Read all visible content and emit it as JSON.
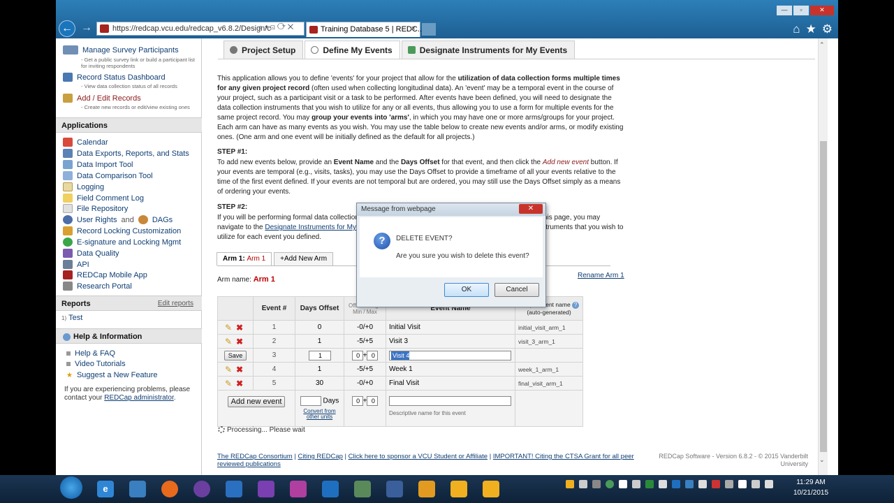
{
  "browser": {
    "url": "https://redcap.vcu.edu/redcap_v6.8.2/Design/c",
    "tab_title": "Training Database 5 | REDC...",
    "tab_close": "×",
    "back": "←",
    "forward": "→",
    "win_min": "—",
    "win_max": "▫",
    "win_close": "✕",
    "home": "⌂",
    "star": "★",
    "gear": "⚙",
    "addr_tools": "⌕ ▾ ⊡ ⟳ ✕"
  },
  "sidebar": {
    "top_items": [
      {
        "label": "Manage Survey Participants",
        "sub": "- Get a public survey link or build a participant list for inviting respondents"
      },
      {
        "label": "Record Status Dashboard",
        "sub": "- View data collection status of all records"
      },
      {
        "label": "Add / Edit Records",
        "sub": "- Create new records or edit/view existing ones"
      }
    ],
    "applications_header": "Applications",
    "applications": [
      "Calendar",
      "Data Exports, Reports, and Stats",
      "Data Import Tool",
      "Data Comparison Tool",
      "Logging",
      "Field Comment Log",
      "File Repository",
      "User Rights",
      "and",
      "DAGs",
      "Record Locking Customization",
      "E-signature and Locking Mgmt",
      "Data Quality",
      "API",
      "REDCap Mobile App",
      "Research Portal"
    ],
    "reports_header": "Reports",
    "edit_reports": "Edit reports",
    "report_num": "1)",
    "report_name": "Test",
    "help_header": "Help & Information",
    "help_items": [
      "Help & FAQ",
      "Video Tutorials",
      "Suggest a New Feature"
    ],
    "problem_text": "If you are experiencing problems, please contact your",
    "admin_link": "REDCap administrator",
    "period": "."
  },
  "project_tabs": [
    "Project Setup",
    "Define My Events",
    "Designate Instruments for My Events"
  ],
  "intro": {
    "p1a": "This application allows you to define 'events' for your project that allow for the ",
    "p1b": "utilization of data collection forms multiple times for any given project record",
    "p1c": " (often used when collecting longitudinal data). An 'event' may be a temporal event in the course of your project, such as a participant visit or a task to be performed. After events have been defined, you will need to designate the data collection instruments that you wish to utilize for any or all events, thus allowing you to use a form for multiple events for the same project record. You may ",
    "p1d": "group your events into 'arms'",
    "p1e": ", in which you may have one or more arms/groups for your project. Each arm can have as many events as you wish. You may use the table below to create new events and/or arms, or modify existing ones. (One arm and one event will be initially defined as the default for all projects.)",
    "step1": "STEP #1:",
    "s1a": "To add new events below, provide an ",
    "s1b": "Event Name",
    "s1c": " and the ",
    "s1d": "Days Offset",
    "s1e": " for that event, and then click the ",
    "s1f": "Add new event",
    "s1g": " button. If your events are temporal (e.g., visits, tasks), you may use the Days Offset to provide a timeframe of all your events relative to the time of the first event defined. If your events are not temporal but are ordered, you may still use the Days Offset simply as a means of ordering your events.",
    "step2": "STEP #2:",
    "s2a": "If you will be performing formal data collection in this project, then once you have defined your events on this page, you may navigate to the ",
    "s2b": "Designate Instruments for My Events",
    "s2c": " page, where you may select which data collection instruments that you wish to utilize for each event you defined."
  },
  "arms": {
    "tab_label": "Arm 1:",
    "tab_name": "Arm 1",
    "add_arm": "+Add New Arm",
    "arm_name_label": "Arm name:",
    "arm_name": "Arm 1",
    "rename": "Rename Arm 1"
  },
  "table": {
    "headers": [
      "Event #",
      "Days Offset",
      "Offset Range Min / Max",
      "Event Name",
      "Unique event name",
      "(auto-generated)"
    ],
    "rows": [
      {
        "num": "1",
        "days": "0",
        "range": "-0/+0",
        "name": "Initial Visit",
        "unique": "initial_visit_arm_1"
      },
      {
        "num": "2",
        "days": "1",
        "range": "-5/+5",
        "name": "Visit 3",
        "unique": "visit_3_arm_1"
      },
      {
        "num": "4",
        "days": "1",
        "range": "-5/+5",
        "name": "Week 1",
        "unique": "week_1_arm_1"
      },
      {
        "num": "5",
        "days": "30",
        "range": "-0/+0",
        "name": "Final Visit",
        "unique": "final_visit_arm_1"
      }
    ],
    "edit_row": {
      "save": "Save",
      "num": "3",
      "days": "1",
      "min": "0",
      "plus": "+",
      "max": "0",
      "name": "Visit 4"
    },
    "add_event": "Add new event",
    "days_label": "Days",
    "convert": "Convert from other units",
    "min_val": "0",
    "max_val": "0",
    "name_hint": "Descriptive name for this event",
    "pencil": "✎",
    "del": "✖"
  },
  "processing": "Processing... Please wait",
  "footer": {
    "links": [
      "The REDCap Consortium",
      "Citing REDCap",
      "Click here to sponsor a VCU Student or Affiliate",
      "IMPORTANT! Citing the CTSA Grant for all peer reviewed publications"
    ],
    "sep": "|",
    "version": "REDCap Software - Version 6.8.2 - © 2015 Vanderbilt University"
  },
  "dialog": {
    "title": "Message from webpage",
    "close": "✕",
    "heading": "DELETE EVENT?",
    "message": "Are you sure you wish to delete this event?",
    "ok": "OK",
    "cancel": "Cancel",
    "icon": "?"
  },
  "taskbar": {
    "time": "11:29 AM",
    "date": "10/21/2015"
  }
}
